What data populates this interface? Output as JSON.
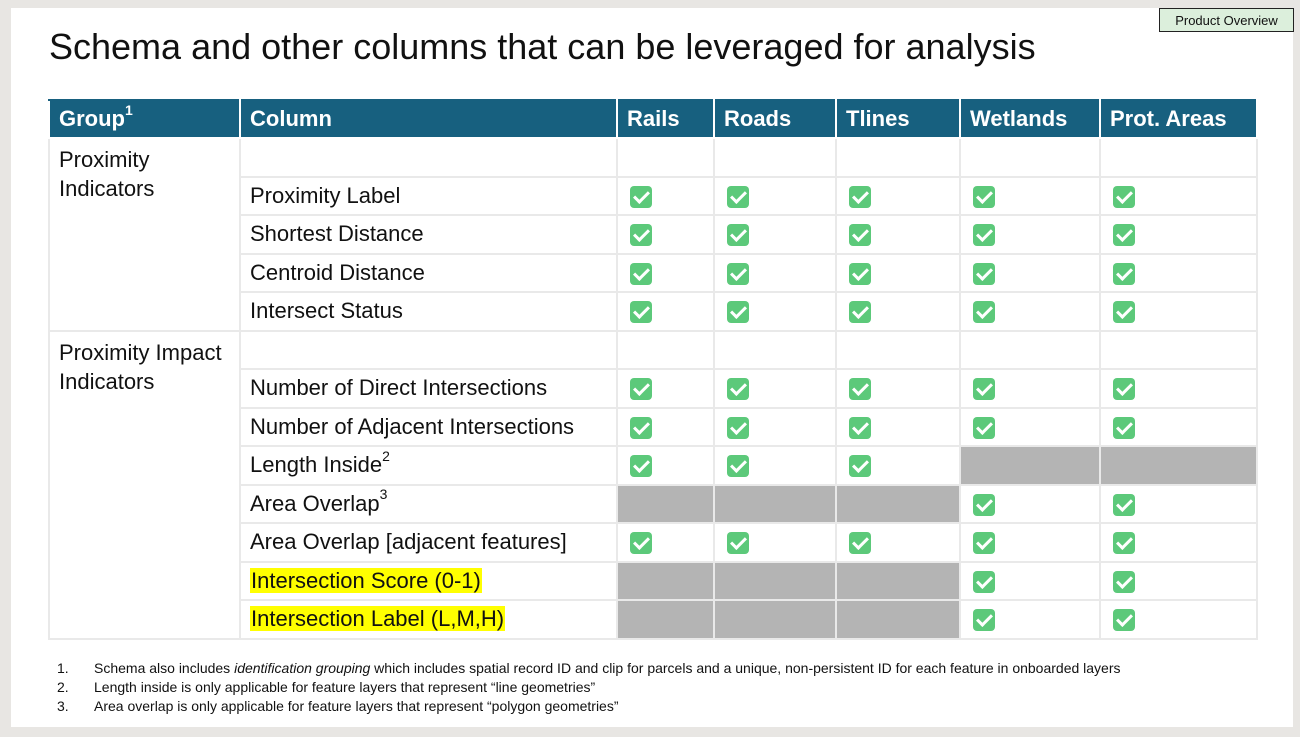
{
  "badge": "Product Overview",
  "title": "Schema and other columns that can be leveraged for analysis",
  "table": {
    "headers": {
      "group": "Group",
      "group_sup": "1",
      "column": "Column",
      "rails": "Rails",
      "roads": "Roads",
      "tlines": "Tlines",
      "wetlands": "Wetlands",
      "prot_areas": "Prot. Areas"
    },
    "groups": {
      "proximity": "Proximity Indicators",
      "impact": "Proximity Impact Indicators"
    },
    "rows": {
      "proximity_label": "Proximity Label",
      "shortest_distance": "Shortest Distance",
      "centroid_distance": "Centroid Distance",
      "intersect_status": "Intersect Status",
      "direct_intersections": "Number of Direct Intersections",
      "adjacent_intersections": "Number of Adjacent Intersections",
      "length_inside": "Length Inside",
      "length_inside_sup": "2",
      "area_overlap": "Area Overlap",
      "area_overlap_sup": "3",
      "area_overlap_adjacent": "Area Overlap [adjacent features]",
      "intersection_score": "Intersection Score (0-1)",
      "intersection_label": "Intersection Label (L,M,H)"
    },
    "availability": [
      {
        "row": "Proximity Label",
        "rails": true,
        "roads": true,
        "tlines": true,
        "wetlands": true,
        "prot_areas": true
      },
      {
        "row": "Shortest Distance",
        "rails": true,
        "roads": true,
        "tlines": true,
        "wetlands": true,
        "prot_areas": true
      },
      {
        "row": "Centroid Distance",
        "rails": true,
        "roads": true,
        "tlines": true,
        "wetlands": true,
        "prot_areas": true
      },
      {
        "row": "Intersect Status",
        "rails": true,
        "roads": true,
        "tlines": true,
        "wetlands": true,
        "prot_areas": true
      },
      {
        "row": "Number of Direct Intersections",
        "rails": true,
        "roads": true,
        "tlines": true,
        "wetlands": true,
        "prot_areas": true
      },
      {
        "row": "Number of Adjacent Intersections",
        "rails": true,
        "roads": true,
        "tlines": true,
        "wetlands": true,
        "prot_areas": true
      },
      {
        "row": "Length Inside",
        "rails": true,
        "roads": true,
        "tlines": true,
        "wetlands": false,
        "prot_areas": false
      },
      {
        "row": "Area Overlap",
        "rails": false,
        "roads": false,
        "tlines": false,
        "wetlands": true,
        "prot_areas": true
      },
      {
        "row": "Area Overlap [adjacent features]",
        "rails": true,
        "roads": true,
        "tlines": true,
        "wetlands": true,
        "prot_areas": true
      },
      {
        "row": "Intersection Score (0-1)",
        "rails": false,
        "roads": false,
        "tlines": false,
        "wetlands": true,
        "prot_areas": true
      },
      {
        "row": "Intersection Label (L,M,H)",
        "rails": false,
        "roads": false,
        "tlines": false,
        "wetlands": true,
        "prot_areas": true
      }
    ]
  },
  "footnotes": [
    {
      "num": "1.",
      "before": "Schema also includes ",
      "emph": "identification grouping",
      "after": " which includes spatial record ID and clip for parcels and a unique, non-persistent ID for each feature in onboarded layers"
    },
    {
      "num": "2.",
      "before": "Length inside is only applicable for feature layers that represent “line geometries”",
      "emph": "",
      "after": ""
    },
    {
      "num": "3.",
      "before": "Area overlap is only applicable for feature layers that represent “polygon geometries”",
      "emph": "",
      "after": ""
    }
  ],
  "colors": {
    "header_bg": "#17607f",
    "check": "#5cc97a",
    "not_applicable": "#b4b4b4",
    "highlight": "#ffff00",
    "badge_bg": "#dcefdc"
  },
  "icons": {
    "check": "check-mark-button-icon"
  }
}
